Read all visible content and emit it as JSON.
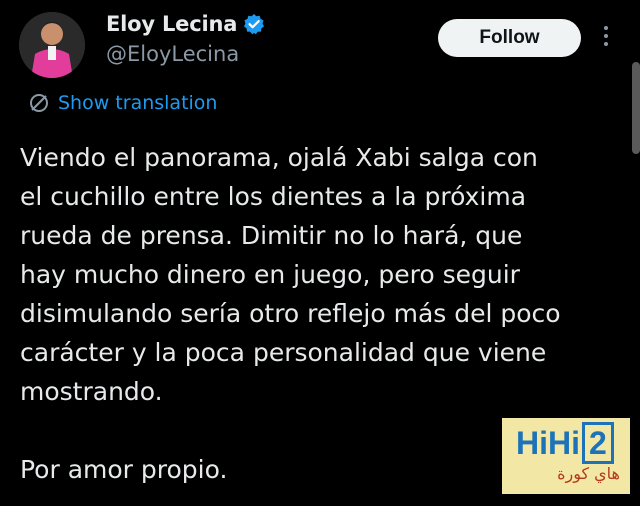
{
  "author": {
    "display_name": "Eloy Lecina",
    "handle": "@EloyLecina"
  },
  "header": {
    "follow_label": "Follow"
  },
  "translate": {
    "label": "Show translation"
  },
  "tweet": {
    "text": "Viendo el panorama, ojalá Xabi salga con\nel cuchillo entre los dientes a la próxima\nrueda de prensa. Dimitir no lo hará, que\nhay mucho dinero en juego, pero seguir\ndisimulando sería otro reflejo más del poco\ncarácter y la poca personalidad que viene\nmostrando.\n\nPor amor propio."
  },
  "watermark": {
    "logo_text": "HiHi",
    "logo_num": "2",
    "subtitle": "هاي كورة"
  },
  "colors": {
    "background": "#000000",
    "text": "#e7e9ea",
    "secondary": "#8b98a5",
    "accent": "#1d9bf0",
    "verified": "#1d9bf0"
  }
}
